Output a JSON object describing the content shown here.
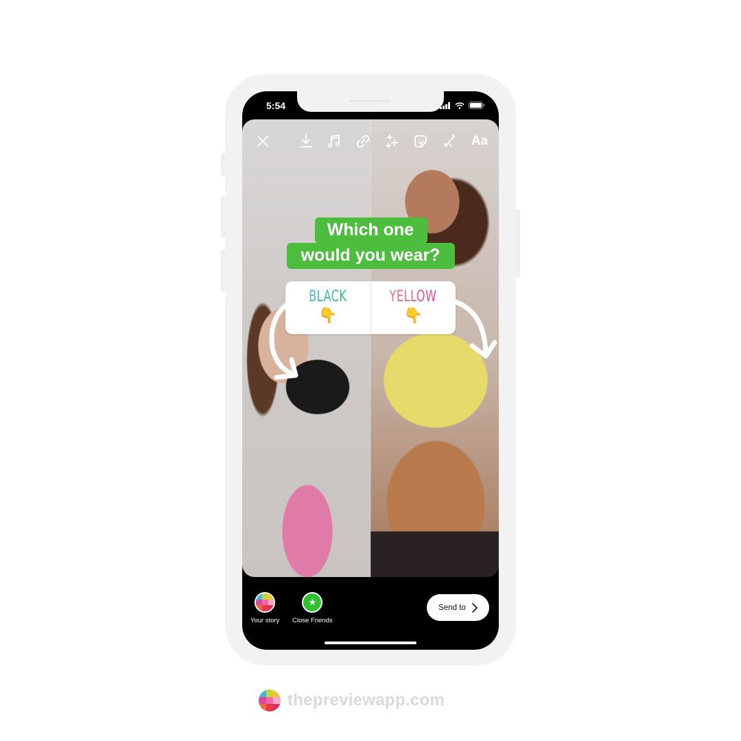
{
  "status_bar": {
    "time": "5:54"
  },
  "toolbar": {
    "icons": [
      "close-icon",
      "download-icon",
      "music-icon",
      "link-icon",
      "effects-icon",
      "sticker-icon",
      "draw-icon",
      "text-icon"
    ],
    "text_label": "Aa"
  },
  "question_sticker": {
    "line1": "Which one",
    "line2": "would you wear?",
    "color": "#4dbd3d"
  },
  "poll": {
    "options": [
      {
        "label": "BLACK",
        "emoji": "👇"
      },
      {
        "label": "YELLOW",
        "emoji": "👇"
      }
    ]
  },
  "share": {
    "your_story": "Your story",
    "close_friends": "Close Friends",
    "send_to": "Send to"
  },
  "footer": {
    "brand": "thepreviewapp.com"
  },
  "colors": {
    "logo_grid": [
      "#3fb5d8",
      "#c9d63a",
      "#f3c22e",
      "#e0479a",
      "#f16aa6",
      "#f7a8c8",
      "#f0673a",
      "#e8354b",
      "#d9305f"
    ]
  }
}
